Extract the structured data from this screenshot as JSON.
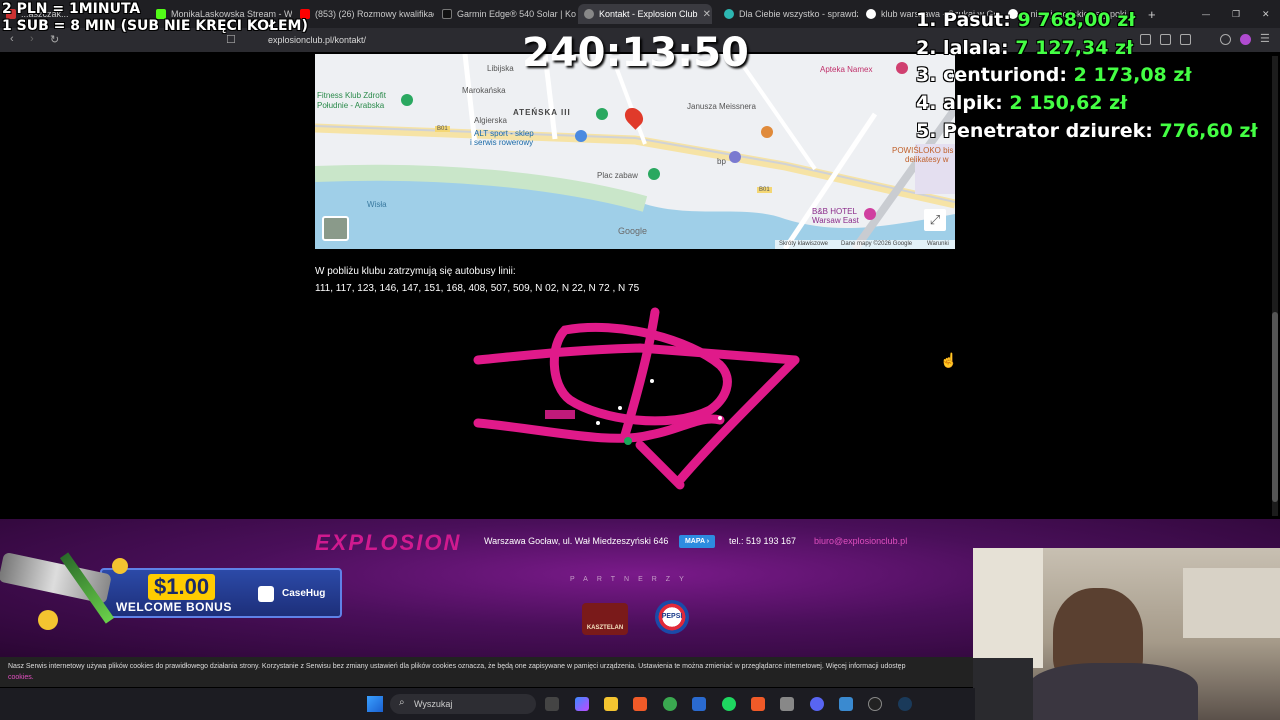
{
  "browser": {
    "tabs": [
      {
        "label": "...aszczak...",
        "color": "#cc3333"
      },
      {
        "label": "MonikaLaskowska Stream - W...",
        "color": "#53fc18"
      },
      {
        "label": "(853) (26) Rozmowy kwalifikac...",
        "color": "#ff0000"
      },
      {
        "label": "Garmin Edge® 540 Solar | Kon...",
        "color": "#111111"
      },
      {
        "label": "Kontakt - Explosion Club",
        "color": "#888888",
        "active": true
      },
      {
        "label": "Dla Ciebie wszystko - sprawdź...",
        "color": "#2db7b2"
      },
      {
        "label": "klub warszawa - Szukaj w Go...",
        "color": "#ffffff"
      },
      {
        "label": "...nie - japońskie saty poki...",
        "color": "#ffffff"
      }
    ],
    "url": "explosionclub.pl/kontakt/"
  },
  "overlay": {
    "rules_line1": "2 PLN = 1MINUTA",
    "rules_line2": "1 SUB = 8 MIN (SUB NIE KRĘCI KOŁEM)",
    "timer": "240:13:50",
    "leaderboard": [
      {
        "rank_name": "1. Pasut:",
        "amount": "9 768,00 zł"
      },
      {
        "rank_name": "2. lalala:",
        "amount": "7 127,34 zł"
      },
      {
        "rank_name": "3. centuriond:",
        "amount": "2 173,08 zł"
      },
      {
        "rank_name": "4. alpik:",
        "amount": "2 150,62 zł"
      },
      {
        "rank_name": "5. Penetrator dziurek:",
        "amount": "776,60 zł"
      }
    ]
  },
  "map": {
    "labels": {
      "libijska": "Libijska",
      "marokanska": "Marokańska",
      "atenska": "ATEŃSKA III",
      "algierska": "Algierska",
      "fitness": "Fitness Klub Zdrofit",
      "fitness2": "Południe - Arabska",
      "alt_sport": "ALT sport - sklep",
      "alt_sport2": "i serwis rowerowy",
      "plac": "Plac zabaw",
      "wisla": "Wisła",
      "apteka": "Apteka Namex",
      "meissnera": "Janusza Meissnera",
      "powislo": "POWIŚLOKO bis",
      "powislo2": "delikatesy w",
      "bb": "B&B HOTEL",
      "bb2": "Warsaw East",
      "road1": "B01",
      "road2": "B01",
      "bp": "bp"
    },
    "attribution": {
      "shortcuts": "Skróty klawiszowe",
      "data": "Dane mapy ©2026 Google",
      "terms": "Warunki",
      "google": "Google"
    }
  },
  "content": {
    "bus_heading": "W pobliżu klubu zatrzymują się autobusy linii:",
    "bus_lines": "111, 117, 123, 146, 147, 151, 168, 408, 507, 509, N 02, N 22, N 72 , N 75"
  },
  "footer": {
    "logo": "EXPLOSION",
    "address": "Warszawa Gocław, ul. Wał Miedzeszyński 646",
    "map_button": "MAPA ›",
    "phone": "tel.: 519 193 167",
    "email": "biuro@explosionclub.pl",
    "partners_heading": "PARTNERZY",
    "partner1": "KASZTELAN",
    "partner2": "PEPSI"
  },
  "ad": {
    "price": "$1.00",
    "bonus": "WELCOME BONUS",
    "brand": "CaseHug"
  },
  "cookie": {
    "text": "Nasz Serwis internetowy używa plików cookies do prawidłowego działania strony. Korzystanie z Serwisu bez zmiany ustawień dla plików cookies oznacza, że będą one zapisywane w pamięci urządzenia. Ustawienia te można zmieniać w przeglądarce internetowej. Więcej informacji udostęp",
    "link": "cookies."
  },
  "taskbar": {
    "search_placeholder": "Wyszukaj"
  }
}
